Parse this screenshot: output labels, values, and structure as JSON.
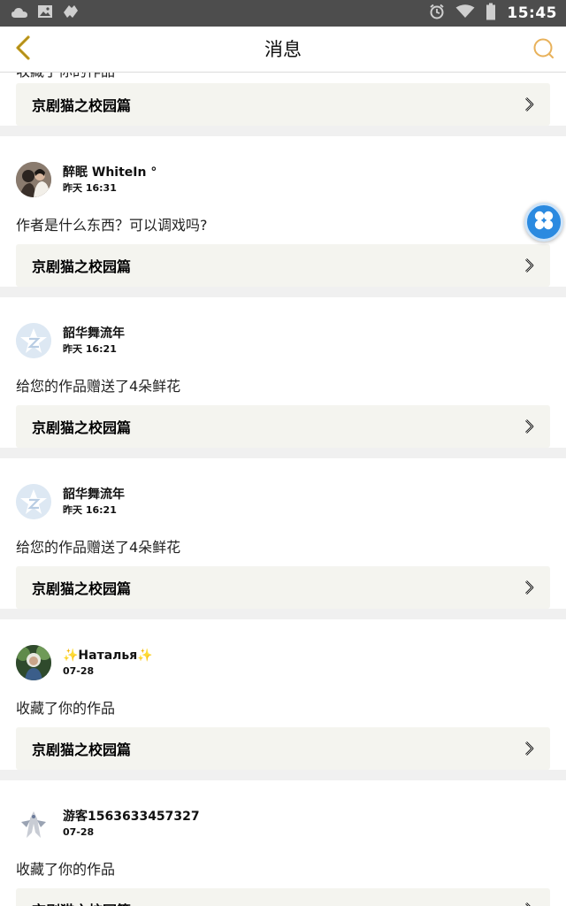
{
  "status_bar": {
    "time": "15:45"
  },
  "header": {
    "title": "消息"
  },
  "feed": {
    "top_partial_message": "收藏了你的作品",
    "top_partial_work": "京剧猫之校园篇",
    "items": [
      {
        "username": "醉眠 WhiteIn",
        "username_suffix": "°",
        "time": "昨天 16:31",
        "message": "作者是什么东西？可以调戏吗?",
        "work": "京剧猫之校园篇",
        "avatar": "photo"
      },
      {
        "username": "韶华舞流年",
        "username_suffix": "",
        "time": "昨天 16:21",
        "message": "给您的作品赠送了4朵鲜花",
        "work": "京剧猫之校园篇",
        "avatar": "default-star"
      },
      {
        "username": "韶华舞流年",
        "username_suffix": "",
        "time": "昨天 16:21",
        "message": "给您的作品赠送了4朵鲜花",
        "work": "京剧猫之校园篇",
        "avatar": "default-star"
      },
      {
        "username": "✨Наталья✨",
        "username_suffix": "",
        "time": "07-28",
        "message": "收藏了你的作品",
        "work": "京剧猫之校园篇",
        "avatar": "photo-green"
      },
      {
        "username": "游客1563633457327",
        "username_suffix": "",
        "time": "07-28",
        "message": "收藏了你的作品",
        "work": "京剧猫之校园篇",
        "avatar": "photo-white"
      }
    ]
  },
  "colors": {
    "accent": "#e8b15a",
    "back_arrow": "#c8a020",
    "float_button": "#2b8ae0",
    "link_bg": "#f4f4ef"
  },
  "icons": {
    "back": "chevron-left-icon",
    "search": "search-icon",
    "floating": "clover-menu-icon",
    "link": "chevron-right-icon"
  }
}
